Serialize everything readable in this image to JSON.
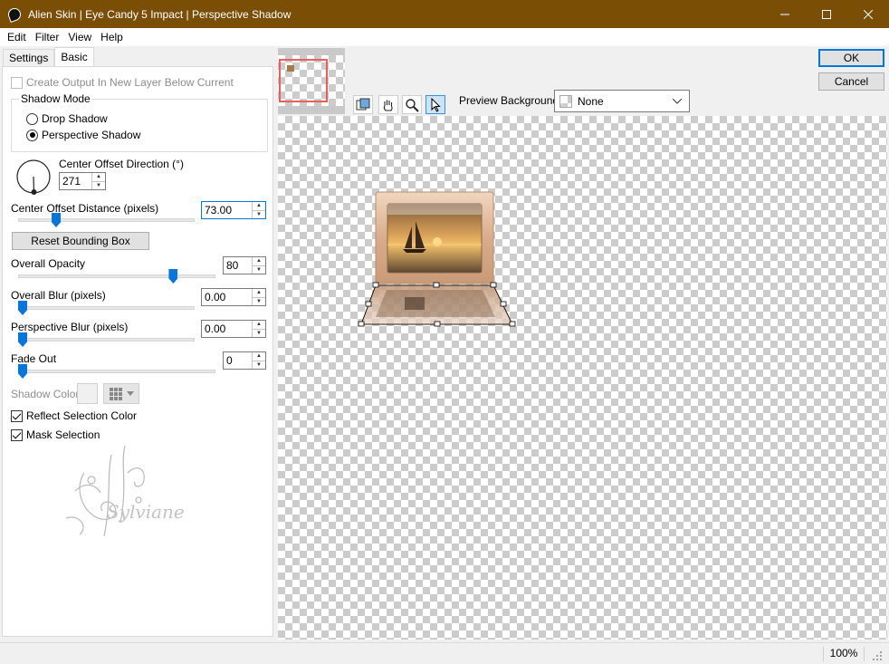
{
  "window": {
    "title": "Alien Skin | Eye Candy 5 Impact | Perspective Shadow",
    "titlebar_color": "#7a4f05"
  },
  "menu": {
    "items": [
      {
        "label": "Edit"
      },
      {
        "label": "Filter"
      },
      {
        "label": "View"
      },
      {
        "label": "Help"
      }
    ]
  },
  "tabs": [
    {
      "label": "Settings",
      "active": false
    },
    {
      "label": "Basic",
      "active": true
    }
  ],
  "basic": {
    "create_output_label": "Create Output In New Layer Below Current",
    "create_output_checked": false,
    "shadow_mode": {
      "title": "Shadow Mode",
      "options": [
        {
          "label": "Drop Shadow",
          "selected": false
        },
        {
          "label": "Perspective Shadow",
          "selected": true
        }
      ]
    },
    "direction": {
      "label": "Center Offset Direction (°)",
      "value": "271"
    },
    "offset_distance": {
      "label": "Center Offset Distance (pixels)",
      "value": "73.00",
      "slider_fraction": 0.2
    },
    "reset_button": "Reset Bounding Box",
    "overall_opacity": {
      "label": "Overall Opacity",
      "value": "80",
      "slider_fraction": 0.8
    },
    "overall_blur": {
      "label": "Overall Blur (pixels)",
      "value": "0.00",
      "slider_fraction": 0
    },
    "perspective_blur": {
      "label": "Perspective Blur (pixels)",
      "value": "0.00",
      "slider_fraction": 0
    },
    "fade_out": {
      "label": "Fade Out",
      "value": "0",
      "slider_fraction": 0
    },
    "shadow_color_label": "Shadow Color",
    "reflect_selection_label": "Reflect Selection Color",
    "reflect_selection_checked": true,
    "mask_selection_label": "Mask Selection",
    "mask_selection_checked": true,
    "watermark_text": "Sylviane"
  },
  "preview": {
    "background_label": "Preview Background:",
    "background_value": "None",
    "tools": [
      "navigate-icon",
      "hand-icon",
      "zoom-icon",
      "pointer-icon"
    ]
  },
  "buttons": {
    "ok": "OK",
    "cancel": "Cancel"
  },
  "status": {
    "zoom": "100%"
  }
}
